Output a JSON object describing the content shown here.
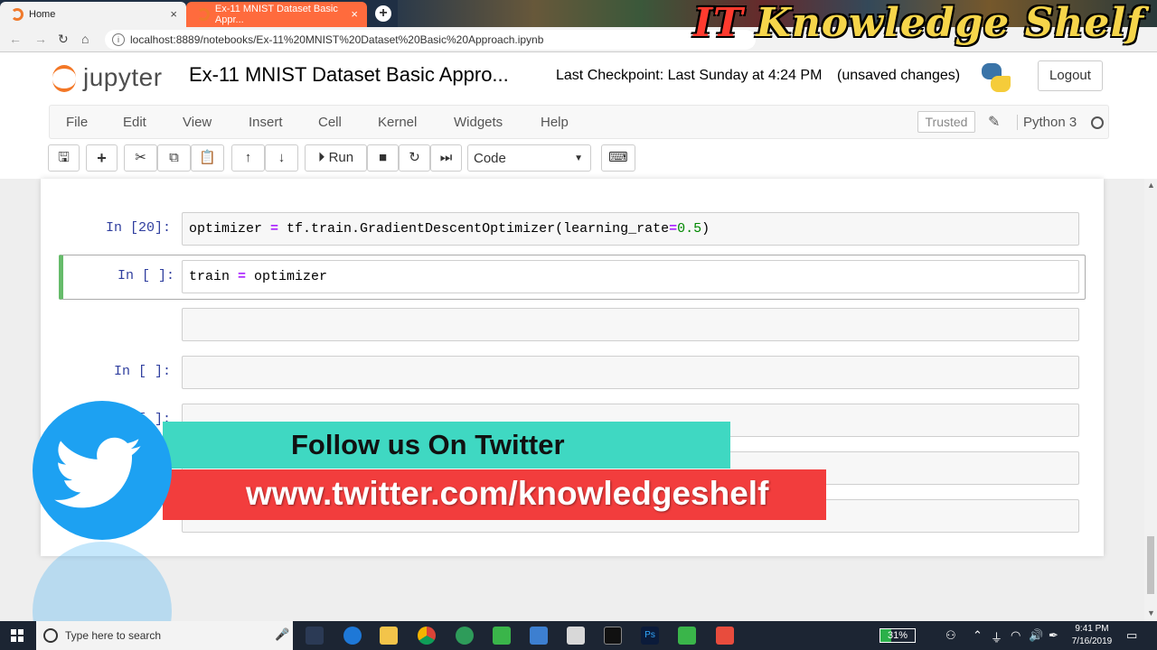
{
  "browser": {
    "tabs": [
      {
        "label": "Home",
        "close": "×"
      },
      {
        "label": "Ex-11 MNIST Dataset Basic Appr...",
        "close": "×"
      }
    ],
    "new_tab": "+",
    "url": "localhost:8889/notebooks/Ex-11%20MNIST%20Dataset%20Basic%20Approach.ipynb",
    "watermark": "IT Knowledge Shelf"
  },
  "jupyter": {
    "logo_text": "jupyter",
    "notebook_title": "Ex-11 MNIST Dataset Basic Appro...",
    "checkpoint": "Last Checkpoint: Last Sunday at 4:24 PM",
    "unsaved": "(unsaved changes)",
    "logout_label": "Logout",
    "menu": [
      "File",
      "Edit",
      "View",
      "Insert",
      "Cell",
      "Kernel",
      "Widgets",
      "Help"
    ],
    "trusted_label": "Trusted",
    "kernel_name": "Python 3",
    "toolbar": {
      "run_label": "Run",
      "cell_type": "Code"
    }
  },
  "cells": [
    {
      "prompt": "In [20]:",
      "code": "optimizer = tf.train.GradientDescentOptimizer(learning_rate=0.5)",
      "selected": false
    },
    {
      "prompt": "In [ ]:",
      "code": "train = optimizer",
      "selected": true
    },
    {
      "prompt": "",
      "code": "",
      "selected": false
    },
    {
      "prompt": "In [ ]:",
      "code": "",
      "selected": false
    },
    {
      "prompt": "In [ ]:",
      "code": "",
      "selected": false
    },
    {
      "prompt": "",
      "code": "",
      "selected": false
    },
    {
      "prompt": "",
      "code": "",
      "selected": false
    }
  ],
  "overlay": {
    "follow_text": "Follow us On Twitter",
    "twitter_url": "www.twitter.com/knowledgeshelf"
  },
  "taskbar": {
    "search_placeholder": "Type here to search",
    "battery": "31%",
    "time": "9:41 PM",
    "date": "7/16/2019"
  }
}
